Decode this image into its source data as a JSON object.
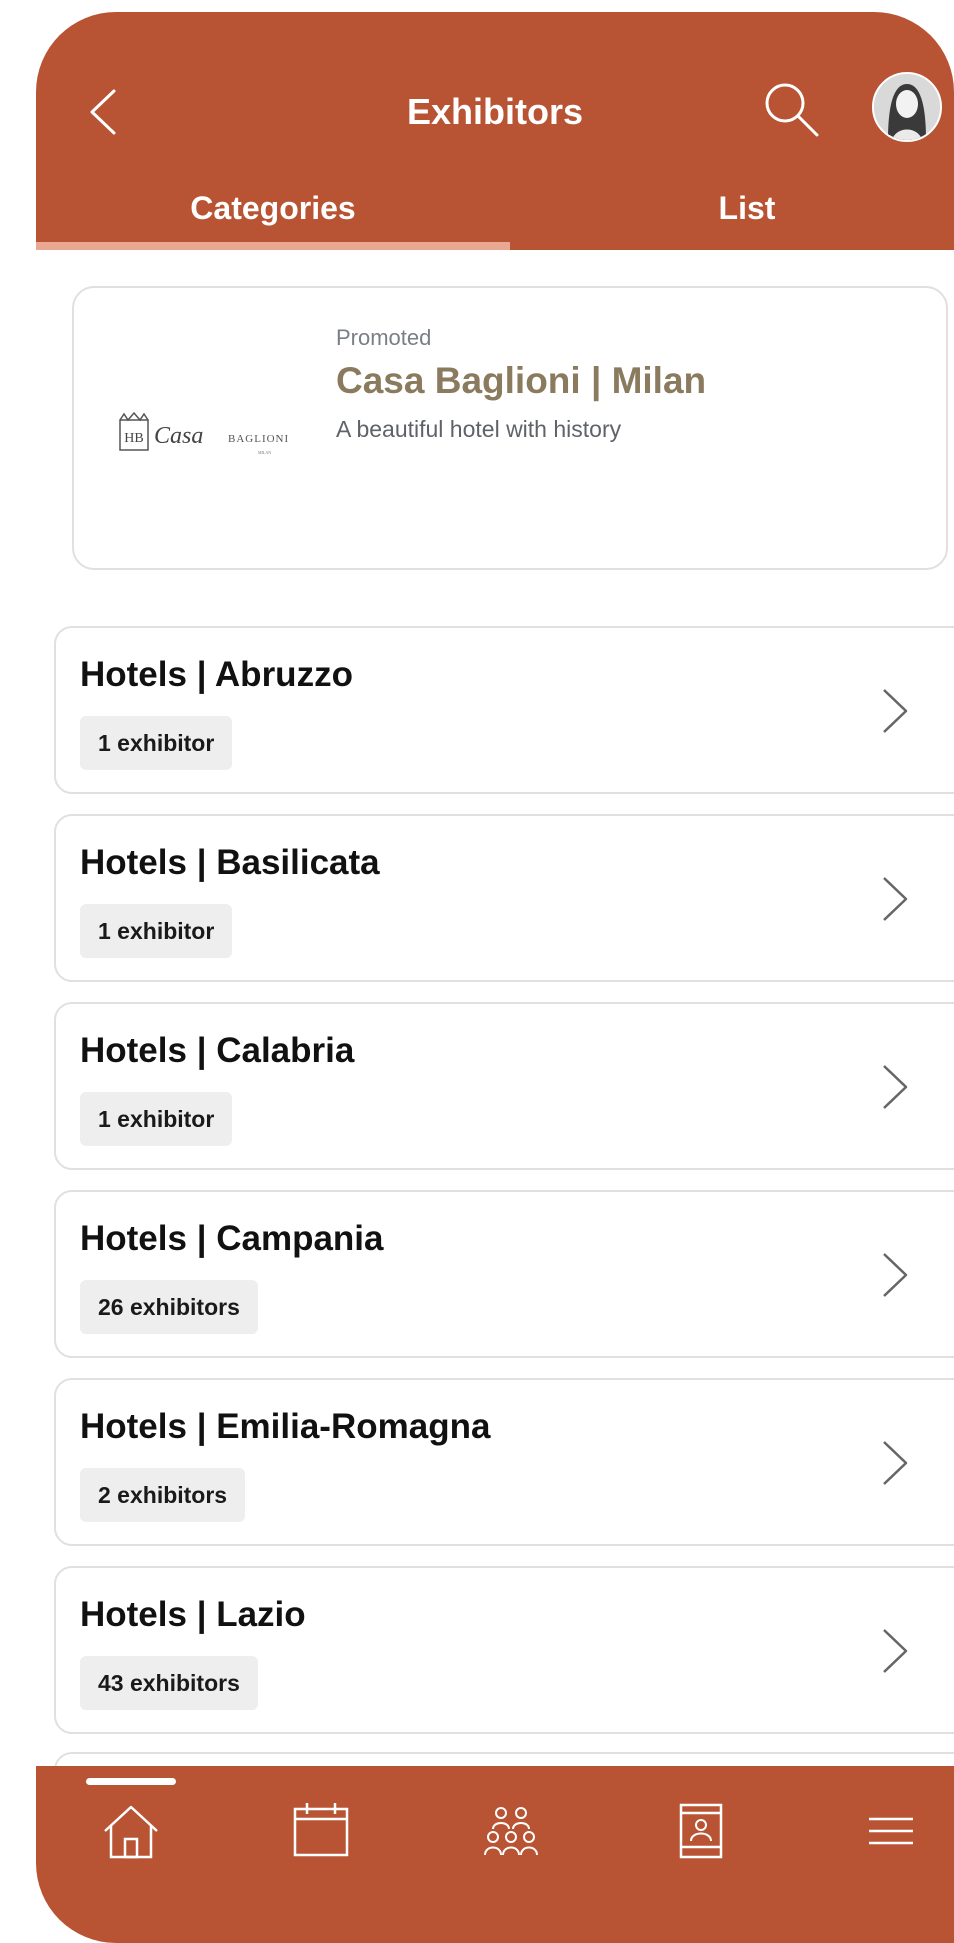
{
  "header": {
    "title": "Exhibitors",
    "back_icon": "back-chevron-icon",
    "search_icon": "search-icon"
  },
  "tabs": [
    {
      "label": "Categories",
      "active": true
    },
    {
      "label": "List",
      "active": false
    }
  ],
  "promoted": {
    "kicker": "Promoted",
    "name": "Casa Baglioni | Milan",
    "description": "A beautiful hotel with history",
    "logo_text": "Casa",
    "logo_brand": "BAGLIONI",
    "logo_city": "MILAN"
  },
  "categories": [
    {
      "name": "Hotels | Abruzzo",
      "count": "1 exhibitor"
    },
    {
      "name": "Hotels | Basilicata",
      "count": "1 exhibitor"
    },
    {
      "name": "Hotels | Calabria",
      "count": "1 exhibitor"
    },
    {
      "name": "Hotels | Campania",
      "count": "26 exhibitors"
    },
    {
      "name": "Hotels | Emilia-Romagna",
      "count": "2 exhibitors"
    },
    {
      "name": "Hotels | Lazio",
      "count": "43 exhibitors"
    }
  ],
  "bottom_nav": [
    {
      "icon": "home-icon",
      "active": true
    },
    {
      "icon": "calendar-icon",
      "active": false
    },
    {
      "icon": "people-icon",
      "active": false
    },
    {
      "icon": "booth-icon",
      "active": false
    },
    {
      "icon": "menu-icon",
      "active": false
    }
  ],
  "colors": {
    "brand": "#b85433",
    "tab_indicator": "#e8a891",
    "promo_name": "#8a7a5e",
    "badge_bg": "#eeeeee"
  }
}
